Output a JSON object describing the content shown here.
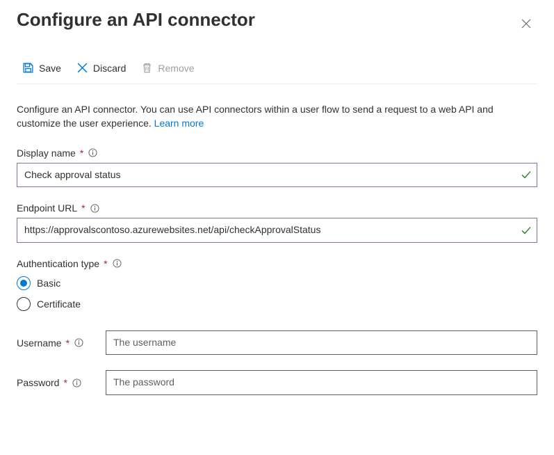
{
  "header": {
    "title": "Configure an API connector"
  },
  "toolbar": {
    "save": "Save",
    "discard": "Discard",
    "remove": "Remove"
  },
  "intro": {
    "text": "Configure an API connector. You can use API connectors within a user flow to send a request to a web API and customize the user experience. ",
    "link": "Learn more"
  },
  "fields": {
    "displayName": {
      "label": "Display name",
      "value": "Check approval status"
    },
    "endpointUrl": {
      "label": "Endpoint URL",
      "value": "https://approvalscontoso.azurewebsites.net/api/checkApprovalStatus"
    },
    "authType": {
      "label": "Authentication type",
      "options": {
        "basic": "Basic",
        "certificate": "Certificate"
      },
      "selected": "basic"
    },
    "username": {
      "label": "Username",
      "placeholder": "The username"
    },
    "password": {
      "label": "Password",
      "placeholder": "The password"
    }
  }
}
